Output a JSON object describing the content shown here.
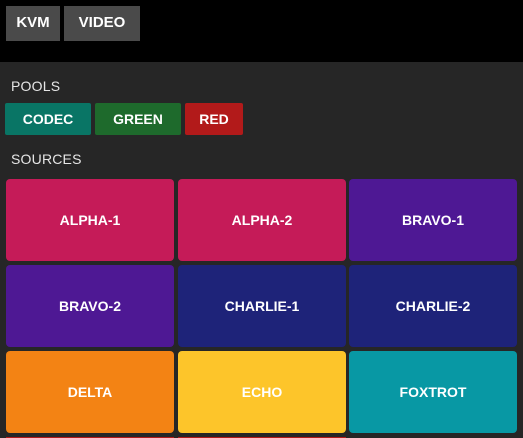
{
  "tabs": [
    {
      "label": "KVM"
    },
    {
      "label": "VIDEO"
    }
  ],
  "pools": {
    "heading": "POOLS",
    "items": [
      {
        "label": "CODEC",
        "color": "#097565"
      },
      {
        "label": "GREEN",
        "color": "#1e6a2c"
      },
      {
        "label": "RED",
        "color": "#b21a1a"
      }
    ]
  },
  "sources": {
    "heading": "SOURCES",
    "items": [
      {
        "label": "ALPHA-1",
        "color": "#c51b58"
      },
      {
        "label": "ALPHA-2",
        "color": "#c51b58"
      },
      {
        "label": "BRAVO-1",
        "color": "#4e1894"
      },
      {
        "label": "BRAVO-2",
        "color": "#4e1894"
      },
      {
        "label": "CHARLIE-1",
        "color": "#1e2379"
      },
      {
        "label": "CHARLIE-2",
        "color": "#1e2379"
      },
      {
        "label": "DELTA",
        "color": "#f38314"
      },
      {
        "label": "ECHO",
        "color": "#fdc52a"
      },
      {
        "label": "FOXTROT",
        "color": "#0898a4"
      }
    ],
    "next_row_color": "#b21a1a"
  }
}
